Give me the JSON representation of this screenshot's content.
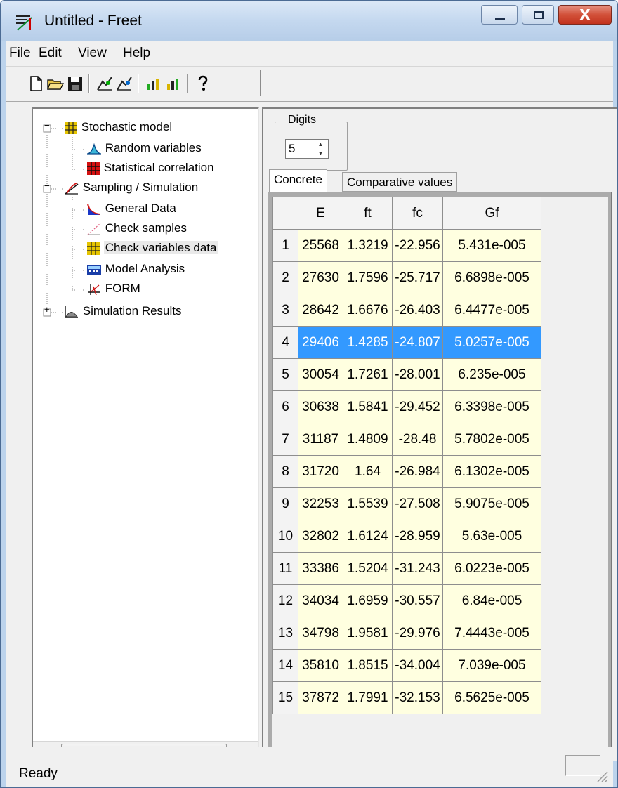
{
  "window": {
    "title": "Untitled - Freet",
    "close_glyph": "X"
  },
  "menu": {
    "file": "File",
    "edit": "Edit",
    "view": "View",
    "help": "Help"
  },
  "toolbar": {
    "icons": [
      "new-file-icon",
      "open-folder-icon",
      "save-disk-icon",
      "graph-icon",
      "graph-alt-icon",
      "bar-chart-icon",
      "bar-chart-alt-icon",
      "help-icon"
    ]
  },
  "tree": {
    "stochastic_model": "Stochastic model",
    "random_variables": "Random variables",
    "statistical_correlation": "Statistical correlation",
    "sampling_simulation": "Sampling / Simulation",
    "general_data": "General Data",
    "check_samples": "Check samples",
    "check_variables_data": "Check variables data",
    "model_analysis": "Model Analysis",
    "form": "FORM",
    "simulation_results": "Simulation Results",
    "expand_minus": "−",
    "expand_plus": "+",
    "scroll_thumb": "III"
  },
  "digits": {
    "label": "Digits",
    "value": "5"
  },
  "tabs": {
    "concrete": "Concrete",
    "comparative": "Comparative values"
  },
  "grid": {
    "headers": [
      "",
      "E",
      "ft",
      "fc",
      "Gf"
    ],
    "rows": [
      [
        "1",
        "25568",
        "1.3219",
        "-22.956",
        "5.431e-005"
      ],
      [
        "2",
        "27630",
        "1.7596",
        "-25.717",
        "6.6898e-005"
      ],
      [
        "3",
        "28642",
        "1.6676",
        "-26.403",
        "6.4477e-005"
      ],
      [
        "4",
        "29406",
        "1.4285",
        "-24.807",
        "5.0257e-005"
      ],
      [
        "5",
        "30054",
        "1.7261",
        "-28.001",
        "6.235e-005"
      ],
      [
        "6",
        "30638",
        "1.5841",
        "-29.452",
        "6.3398e-005"
      ],
      [
        "7",
        "31187",
        "1.4809",
        "-28.48",
        "5.7802e-005"
      ],
      [
        "8",
        "31720",
        "1.64",
        "-26.984",
        "6.1302e-005"
      ],
      [
        "9",
        "32253",
        "1.5539",
        "-27.508",
        "5.9075e-005"
      ],
      [
        "10",
        "32802",
        "1.6124",
        "-28.959",
        "5.63e-005"
      ],
      [
        "11",
        "33386",
        "1.5204",
        "-31.243",
        "6.0223e-005"
      ],
      [
        "12",
        "34034",
        "1.6959",
        "-30.557",
        "6.84e-005"
      ],
      [
        "13",
        "34798",
        "1.9581",
        "-29.976",
        "7.4443e-005"
      ],
      [
        "14",
        "35810",
        "1.8515",
        "-34.004",
        "7.039e-005"
      ],
      [
        "15",
        "37872",
        "1.7991",
        "-32.153",
        "6.5625e-005"
      ]
    ],
    "selected_row": 4,
    "cell_color": "#ffffe0",
    "selection_color": "#3399ff"
  },
  "status": {
    "text": "Ready"
  }
}
